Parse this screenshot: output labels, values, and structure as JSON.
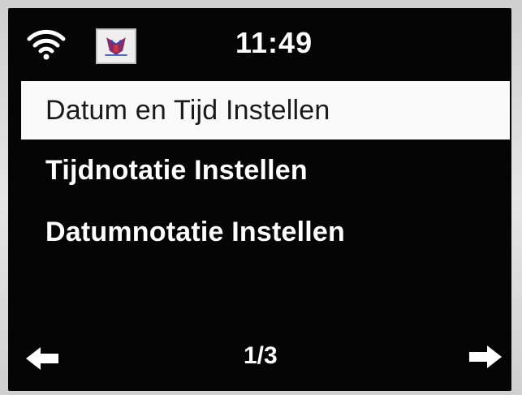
{
  "status_bar": {
    "wifi_icon": "wifi-icon",
    "station_icon": "station-logo-icon",
    "time": "11:49"
  },
  "menu": {
    "items": [
      {
        "label": "Datum en Tijd Instellen",
        "selected": true
      },
      {
        "label": "Tijdnotatie Instellen",
        "selected": false
      },
      {
        "label": "Datumnotatie Instellen",
        "selected": false
      }
    ]
  },
  "footer": {
    "prev_icon": "arrow-left-icon",
    "next_icon": "arrow-right-icon",
    "page": "1/3"
  },
  "colors": {
    "screen_background": "#050505",
    "text": "#ffffff",
    "selection_background": "#fafafa",
    "selection_text": "#1a1a1a"
  }
}
